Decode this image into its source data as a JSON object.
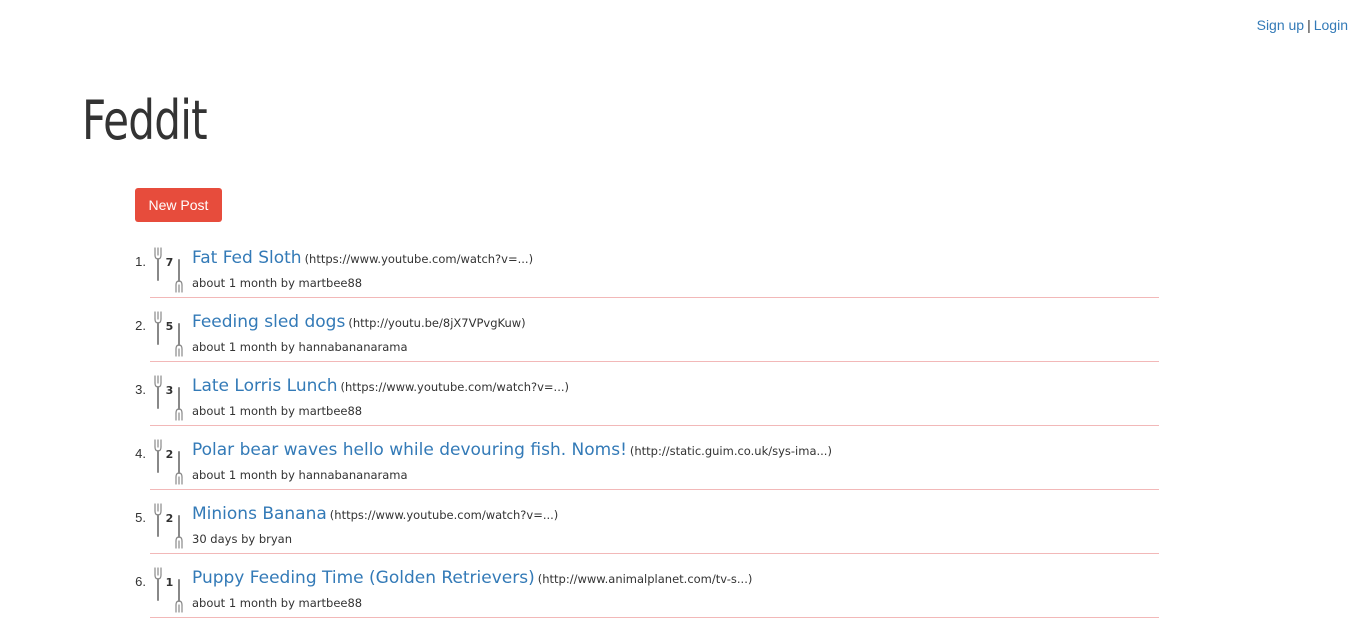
{
  "header": {
    "signup_label": "Sign up",
    "separator": "|",
    "login_label": "Login"
  },
  "site": {
    "title": "Feddit"
  },
  "toolbar": {
    "new_post_label": "New Post"
  },
  "posts": [
    {
      "rank": "1.",
      "score": "7",
      "title": "Fat Fed Sloth",
      "url": "(https://www.youtube.com/watch?v=...)",
      "meta": "about 1 month by martbee88"
    },
    {
      "rank": "2.",
      "score": "5",
      "title": "Feeding sled dogs",
      "url": "(http://youtu.be/8jX7VPvgKuw)",
      "meta": "about 1 month by hannabananarama"
    },
    {
      "rank": "3.",
      "score": "3",
      "title": "Late Lorris Lunch",
      "url": "(https://www.youtube.com/watch?v=...)",
      "meta": "about 1 month by martbee88"
    },
    {
      "rank": "4.",
      "score": "2",
      "title": "Polar bear waves hello while devouring fish. Noms!",
      "url": "(http://static.guim.co.uk/sys-ima...)",
      "meta": "about 1 month by hannabananarama"
    },
    {
      "rank": "5.",
      "score": "2",
      "title": "Minions Banana",
      "url": "(https://www.youtube.com/watch?v=...)",
      "meta": "30 days by bryan"
    },
    {
      "rank": "6.",
      "score": "1",
      "title": "Puppy Feeding Time (Golden Retrievers)",
      "url": "(http://www.animalplanet.com/tv-s...)",
      "meta": "about 1 month by martbee88"
    }
  ],
  "icons": {
    "upvote": "fork-up-icon",
    "downvote": "fork-down-icon"
  },
  "colors": {
    "link": "#337ab7",
    "button": "#e74c3c",
    "divider": "#f2b8b8",
    "icon": "#888888"
  }
}
